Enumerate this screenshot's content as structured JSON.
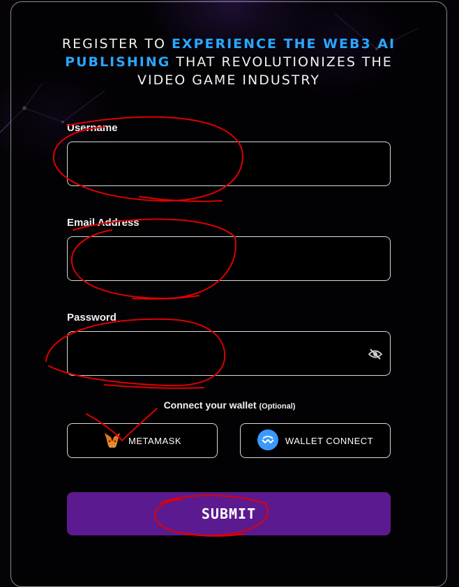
{
  "heading": {
    "part1": "REGISTER TO ",
    "highlight": "EXPERIENCE THE WEB3 AI PUBLISHING",
    "part2": " THAT REVOLUTIONIZES THE VIDEO GAME INDUSTRY"
  },
  "form": {
    "username": {
      "label": "Username",
      "value": "",
      "placeholder": ""
    },
    "email": {
      "label": "Email Address",
      "value": "",
      "placeholder": ""
    },
    "password": {
      "label": "Password",
      "value": "",
      "placeholder": "",
      "toggle_icon": "eye-off-icon"
    }
  },
  "wallet": {
    "label": "Connect your wallet",
    "optional": "(Optional)",
    "buttons": [
      {
        "label": "METAMASK",
        "icon": "metamask-fox-icon"
      },
      {
        "label": "WALLET CONNECT",
        "icon": "walletconnect-icon"
      }
    ]
  },
  "submit_label": "SUBMIT",
  "colors": {
    "accent": "#2aa7ff",
    "submit_bg": "#5c1a90",
    "annotation": "#e00000"
  }
}
